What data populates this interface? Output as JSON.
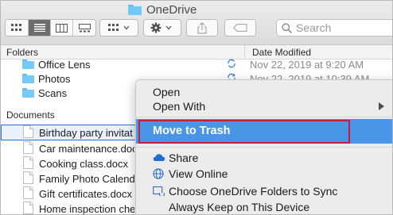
{
  "window": {
    "title": "OneDrive"
  },
  "search": {
    "placeholder": "Search"
  },
  "columns": {
    "folders": "Folders",
    "date_modified": "Date Modified"
  },
  "folders": [
    {
      "name": "Office Lens",
      "date": "Nov 22, 2019 at 9:20 AM"
    },
    {
      "name": "Photos",
      "date": "Nov 22, 2019 at 10:39 AM"
    },
    {
      "name": "Scans",
      "date": ""
    }
  ],
  "documents": {
    "title": "Documents",
    "items": [
      {
        "name": "Birthday party invitat"
      },
      {
        "name": "Car maintenance.docx"
      },
      {
        "name": "Cooking class.docx"
      },
      {
        "name": "Family Photo Calenda"
      },
      {
        "name": "Gift certificates.docx"
      },
      {
        "name": "Home inspection che"
      }
    ]
  },
  "context_menu": {
    "open": "Open",
    "open_with": "Open With",
    "move_to_trash": "Move to Trash",
    "share": "Share",
    "view_online": "View Online",
    "choose_folders": "Choose OneDrive Folders to Sync",
    "always_keep": "Always Keep on This Device"
  },
  "colors": {
    "highlight": "#4b95e8",
    "annotation_box": "#cc1a35",
    "folder": "#75c9f7"
  },
  "icons": {
    "sync": "sync-icon",
    "cloud": "onedrive-cloud-icon",
    "globe": "globe-icon",
    "folders_sync": "folder-sync-icon"
  }
}
